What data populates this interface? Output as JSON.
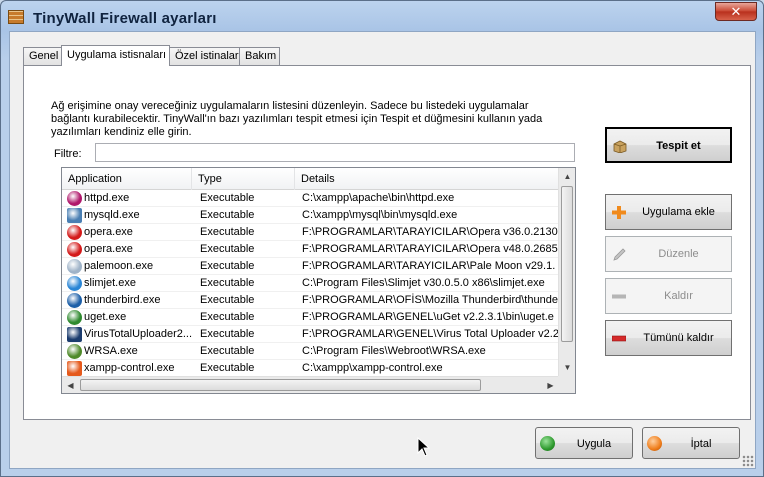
{
  "window": {
    "title": "TinyWall Firewall ayarları",
    "close_glyph": "✕"
  },
  "tabs": [
    {
      "label": "Genel",
      "active": false
    },
    {
      "label": "Uygulama istisnaları",
      "active": true
    },
    {
      "label": "Özel istinalar",
      "active": false
    },
    {
      "label": "Bakım",
      "active": false
    }
  ],
  "description": "Ağ erişimine onay vereceğiniz uygulamaların listesini düzenleyin. Sadece bu listedeki uygulamalar bağlantı kurabilecektir. TinyWall'ın bazı yazılımları tespit etmesi için Tespit et düğmesini kullanın yada yazılımları kendiniz elle girin.",
  "filter": {
    "label": "Filtre:",
    "value": "",
    "placeholder": ""
  },
  "list": {
    "columns": [
      "Application",
      "Type",
      "Details"
    ],
    "rows": [
      {
        "name": "httpd.exe",
        "type": "Executable",
        "details": "C:\\xampp\\apache\\bin\\httpd.exe",
        "icon": "feather-icon",
        "color": "#b0176b"
      },
      {
        "name": "mysqld.exe",
        "type": "Executable",
        "details": "C:\\xampp\\mysql\\bin\\mysqld.exe",
        "icon": "window-app-icon",
        "color": "#4a7fb3"
      },
      {
        "name": "opera.exe",
        "type": "Executable",
        "details": "F:\\PROGRAMLAR\\TARAYICILAR\\Opera v36.0.2130",
        "icon": "opera-icon",
        "color": "#d41a1a"
      },
      {
        "name": "opera.exe",
        "type": "Executable",
        "details": "F:\\PROGRAMLAR\\TARAYICILAR\\Opera v48.0.2685",
        "icon": "opera-icon",
        "color": "#d41a1a"
      },
      {
        "name": "palemoon.exe",
        "type": "Executable",
        "details": "F:\\PROGRAMLAR\\TARAYICILAR\\Pale Moon v29.1.",
        "icon": "palemoon-icon",
        "color": "#9fb3c8"
      },
      {
        "name": "slimjet.exe",
        "type": "Executable",
        "details": "C:\\Program Files\\Slimjet v30.0.5.0 x86\\slimjet.exe",
        "icon": "slimjet-icon",
        "color": "#2a86d6"
      },
      {
        "name": "thunderbird.exe",
        "type": "Executable",
        "details": "F:\\PROGRAMLAR\\OFİS\\Mozilla Thunderbird\\thunde",
        "icon": "thunderbird-icon",
        "color": "#1c5fa8"
      },
      {
        "name": "uget.exe",
        "type": "Executable",
        "details": "F:\\PROGRAMLAR\\GENEL\\uGet v2.2.3.1\\bin\\uget.e",
        "icon": "uget-icon",
        "color": "#2f8a2f"
      },
      {
        "name": "VirusTotalUploader2...",
        "type": "Executable",
        "details": "F:\\PROGRAMLAR\\GENEL\\Virus Total Uploader v2.2",
        "icon": "virustotal-icon",
        "color": "#1b3c6e"
      },
      {
        "name": "WRSA.exe",
        "type": "Executable",
        "details": "C:\\Program Files\\Webroot\\WRSA.exe",
        "icon": "webroot-icon",
        "color": "#4f8a2a"
      },
      {
        "name": "xampp-control.exe",
        "type": "Executable",
        "details": "C:\\xampp\\xampp-control.exe",
        "icon": "xampp-icon",
        "color": "#e5591b"
      }
    ]
  },
  "buttons": {
    "detect": "Tespit et",
    "add": "Uygulama ekle",
    "edit": "Düzenle",
    "remove": "Kaldır",
    "remove_all": "Tümünü kaldır",
    "apply": "Uygula",
    "cancel": "İptal"
  },
  "colors": {
    "accent_add": "#f08a1c",
    "remove": "#d52a2a",
    "apply": "#2e9a2e",
    "cancel": "#ef7d1a"
  }
}
